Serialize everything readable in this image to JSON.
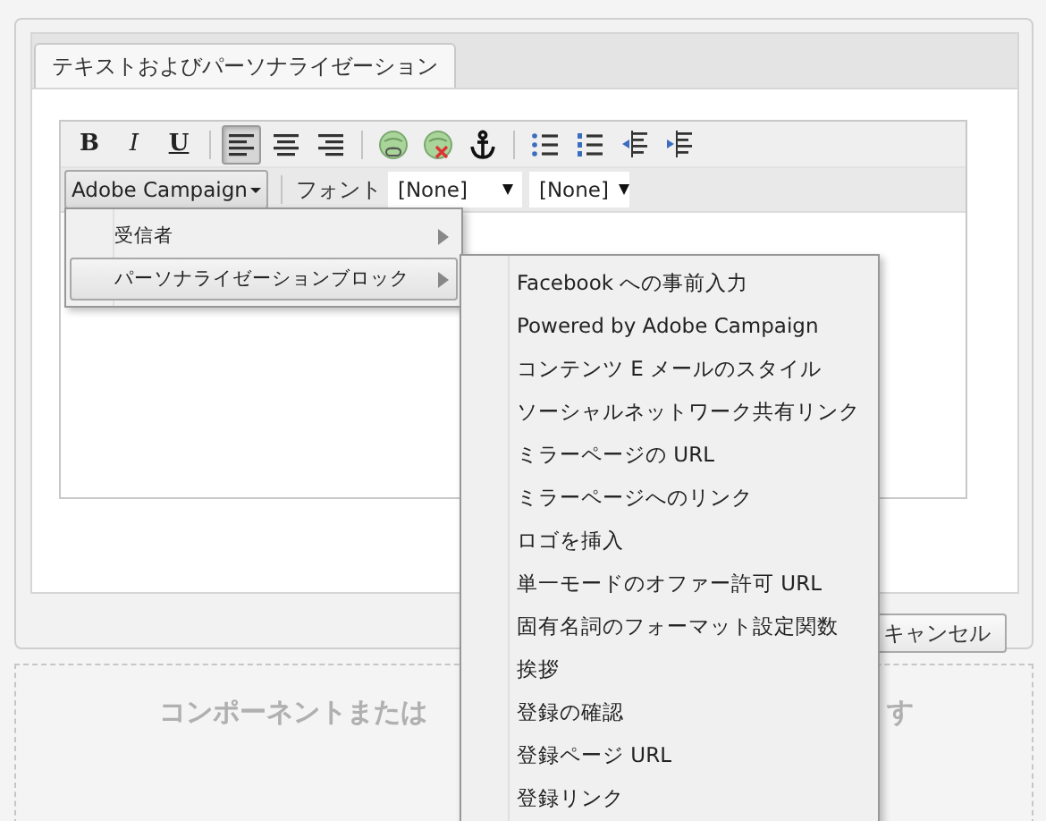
{
  "tabs": [
    {
      "label": "テキストおよびパーソナライゼーション",
      "selected": true
    }
  ],
  "toolbar": {
    "format_buttons": [
      {
        "label": "B",
        "kind": "bold"
      },
      {
        "label": "I",
        "kind": "italic"
      },
      {
        "label": "U",
        "kind": "underline"
      }
    ],
    "align_buttons": [
      {
        "kind": "left",
        "selected": true
      },
      {
        "kind": "center",
        "selected": false
      },
      {
        "kind": "right",
        "selected": false
      }
    ],
    "insert_buttons": [
      {
        "kind": "link"
      },
      {
        "kind": "unlink"
      },
      {
        "kind": "anchor"
      }
    ],
    "list_buttons": [
      {
        "kind": "bullets"
      },
      {
        "kind": "numbers"
      },
      {
        "kind": "outdent"
      },
      {
        "kind": "indent"
      }
    ],
    "campaign_button": "Adobe Campaign",
    "font_label": "フォント",
    "font_select": "[None]",
    "size_select": "[None]"
  },
  "menu": {
    "items": [
      {
        "label": "受信者",
        "selected": false,
        "submenu": true
      },
      {
        "label": "パーソナライゼーションブロック",
        "selected": true,
        "submenu": true
      }
    ]
  },
  "submenu": {
    "items": [
      {
        "label": "Facebook への事前入力"
      },
      {
        "label": "Powered by Adobe Campaign"
      },
      {
        "label": "コンテンツ E メールのスタイル"
      },
      {
        "label": "ソーシャルネットワーク共有リンク"
      },
      {
        "label": "ミラーページの URL"
      },
      {
        "label": "ミラーページへのリンク"
      },
      {
        "label": "ロゴを挿入"
      },
      {
        "label": "単一モードのオファー許可 URL"
      },
      {
        "label": "固有名詞のフォーマット設定関数"
      },
      {
        "label": "挨拶"
      },
      {
        "label": "登録の確認"
      },
      {
        "label": "登録ページ URL"
      },
      {
        "label": "登録リンク"
      }
    ]
  },
  "footer": {
    "cancel_button": "キャンセル"
  },
  "drop_zone": {
    "text_parts": [
      "コンポーネントまたは",
      "す"
    ]
  }
}
